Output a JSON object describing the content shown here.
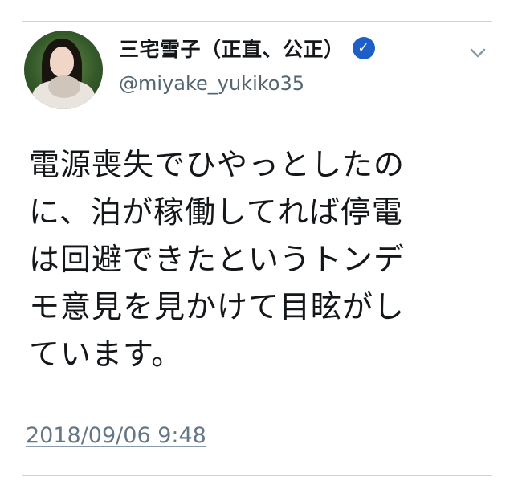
{
  "tweet": {
    "author": {
      "display_name": "三宅雪子（正直、公正）",
      "handle": "@miyake_yukiko35",
      "verified_icon": "verified-badge-icon",
      "badge_color": "#1d5fc7"
    },
    "text": "電源喪失でひやっとしたの\nに、泊が稼働してれば停電\nは回避できたというトンデ\nモ意見を見かけて目眩がし\nています。",
    "timestamp": "2018/09/06 9:48"
  }
}
